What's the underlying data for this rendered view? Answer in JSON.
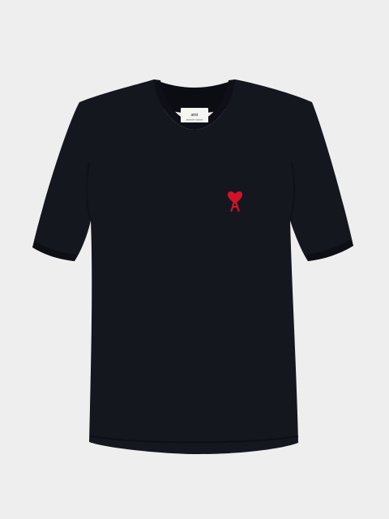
{
  "image": {
    "subject": "t-shirt",
    "background_color": "#EEEEEE",
    "garment_color": "#15171F",
    "garment_shadow": "#0C0D13",
    "label_color": "#F5F5F2",
    "logo_color": "#D3122A"
  },
  "label": {
    "brand_text": "ami",
    "sub_text": "alexandre mattiussi"
  }
}
